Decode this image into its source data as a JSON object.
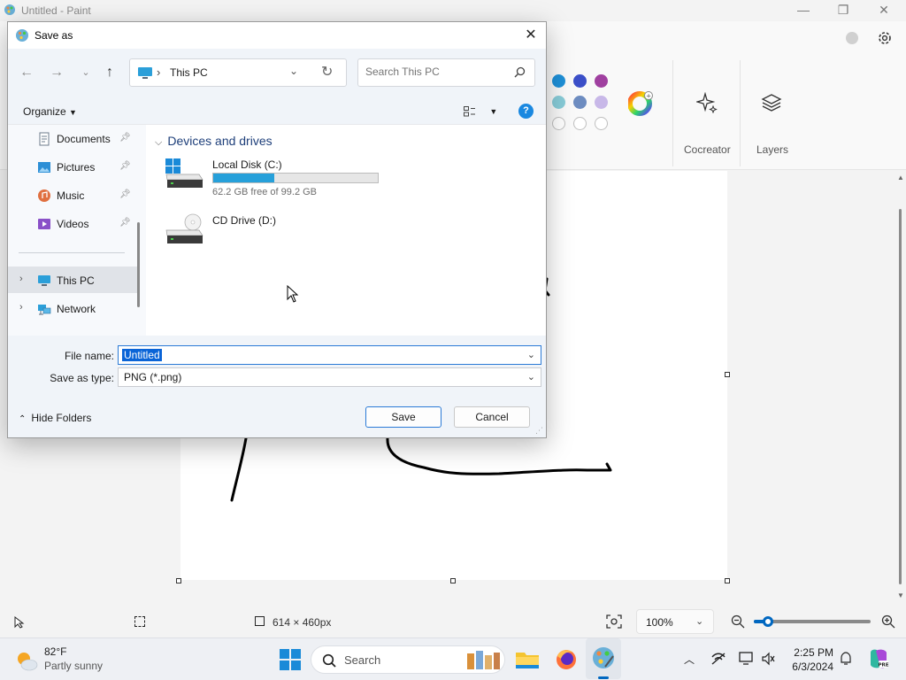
{
  "paint": {
    "title": "Untitled - Paint",
    "ribbon": {
      "colors": {
        "row1": [
          "#1e90d8",
          "#3b4fc8",
          "#a040a0"
        ],
        "row2": [
          "#88ccd8",
          "#6d8cc0",
          "#c8b8e8"
        ]
      },
      "cocreator_label": "Cocreator",
      "layers_label": "Layers"
    },
    "statusbar": {
      "canvas_size": "614 × 460px",
      "zoom": "100%",
      "zoom_level": 0.12
    }
  },
  "dialog": {
    "title": "Save as",
    "address": {
      "crumb": "This PC"
    },
    "search_placeholder": "Search This PC",
    "organize_label": "Organize",
    "help_label": "?",
    "nav_items": [
      {
        "label": "Documents"
      },
      {
        "label": "Pictures"
      },
      {
        "label": "Music"
      },
      {
        "label": "Videos"
      },
      {
        "label": "This PC"
      },
      {
        "label": "Network"
      }
    ],
    "group_header": "Devices and drives",
    "drives": [
      {
        "name": "Local Disk (C:)",
        "free_text": "62.2 GB free of 99.2 GB",
        "used_fraction": 0.373
      },
      {
        "name": "CD Drive (D:)"
      }
    ],
    "file_name_label": "File name:",
    "file_name_value": "Untitled",
    "save_type_label": "Save as type:",
    "save_type_value": "PNG (*.png)",
    "hide_folders_label": "Hide Folders",
    "save_button": "Save",
    "cancel_button": "Cancel"
  },
  "taskbar": {
    "weather_temp": "82°F",
    "weather_condition": "Partly sunny",
    "search_label": "Search",
    "time": "2:25 PM",
    "date": "6/3/2024"
  }
}
